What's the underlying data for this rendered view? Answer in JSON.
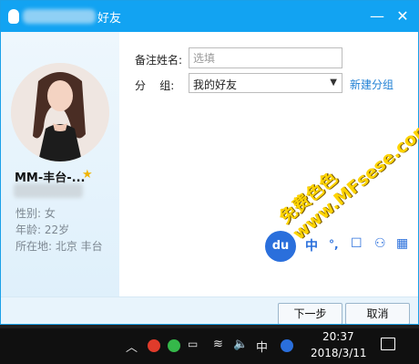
{
  "dialog": {
    "title": "好友",
    "minimize_glyph": "—",
    "close_glyph": "✕"
  },
  "profile": {
    "name": "MM-丰台-...",
    "gender": "性别: 女",
    "age": "年龄: 22岁",
    "location": "所在地: 北京  丰台"
  },
  "form": {
    "remark_label": "备注姓名:",
    "remark_placeholder": "选填",
    "group_label": "分    组:",
    "group_value": "我的好友",
    "new_group_link": "新建分组"
  },
  "buttons": {
    "next": "下一步",
    "cancel": "取消"
  },
  "ime": {
    "logo": "du",
    "mode": "中"
  },
  "taskbar": {
    "ime_indicator": "中",
    "time": "20:37",
    "date": "2018/3/11"
  },
  "watermark": {
    "line1": "免费色色",
    "line2": "www.MFsese.com"
  },
  "colors": {
    "titlebar": "#12a3f2",
    "link": "#1e7fd4",
    "watermark": "#ffd400",
    "taskbar": "#101010"
  }
}
